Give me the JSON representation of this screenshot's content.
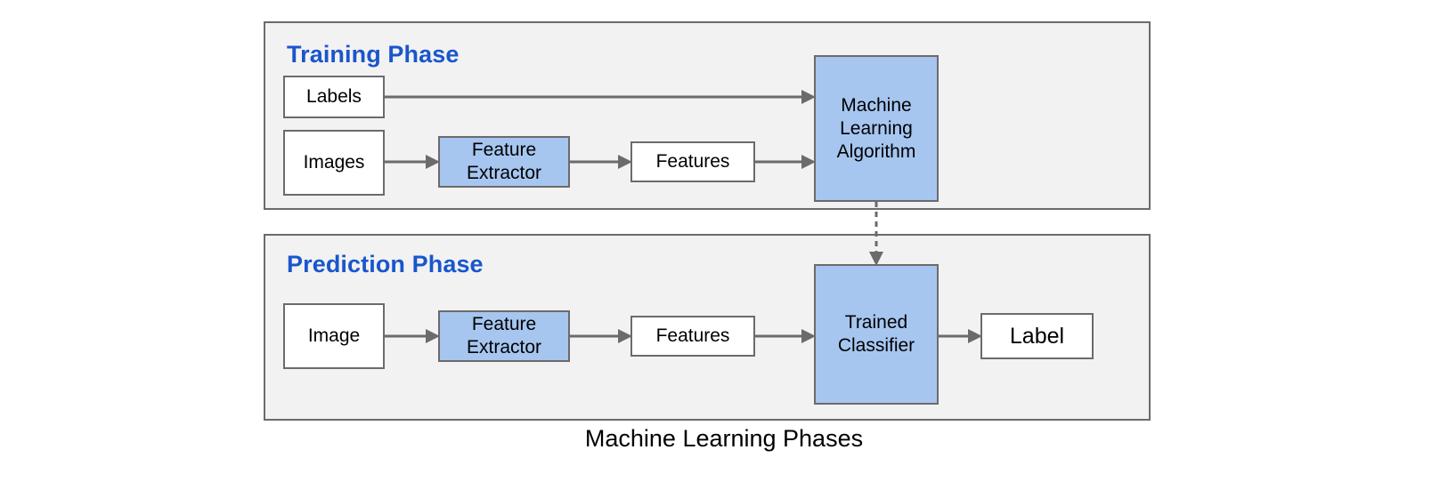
{
  "caption": "Machine Learning Phases",
  "colors": {
    "panel_background": "#f2f2f2",
    "panel_border": "#6b6b6b",
    "phase_title": "#1a56cc",
    "node_white": "#ffffff",
    "node_blue": "#a6c6f0",
    "node_border": "#6b6b6b",
    "connector": "#6b6b6b",
    "text": "#000000"
  },
  "phases": [
    {
      "id": "training",
      "title": "Training Phase",
      "nodes": [
        {
          "id": "labels",
          "label": "Labels",
          "style": "white"
        },
        {
          "id": "images",
          "label": "Images",
          "style": "white"
        },
        {
          "id": "feature_extractor",
          "label": "Feature\nExtractor",
          "style": "blue"
        },
        {
          "id": "features",
          "label": "Features",
          "style": "white"
        },
        {
          "id": "ml_algorithm",
          "label": "Machine\nLearning\nAlgorithm",
          "style": "blue"
        }
      ],
      "edges": [
        {
          "from": "labels",
          "to": "ml_algorithm",
          "style": "solid"
        },
        {
          "from": "images",
          "to": "feature_extractor",
          "style": "solid"
        },
        {
          "from": "feature_extractor",
          "to": "features",
          "style": "solid"
        },
        {
          "from": "features",
          "to": "ml_algorithm",
          "style": "solid"
        }
      ]
    },
    {
      "id": "prediction",
      "title": "Prediction Phase",
      "nodes": [
        {
          "id": "image",
          "label": "Image",
          "style": "white"
        },
        {
          "id": "feature_extractor",
          "label": "Feature\nExtractor",
          "style": "blue"
        },
        {
          "id": "features",
          "label": "Features",
          "style": "white"
        },
        {
          "id": "trained_classifier",
          "label": "Trained\nClassifier",
          "style": "blue"
        },
        {
          "id": "label",
          "label": "Label",
          "style": "white"
        }
      ],
      "edges": [
        {
          "from": "image",
          "to": "feature_extractor",
          "style": "solid"
        },
        {
          "from": "feature_extractor",
          "to": "features",
          "style": "solid"
        },
        {
          "from": "features",
          "to": "trained_classifier",
          "style": "solid"
        },
        {
          "from": "trained_classifier",
          "to": "label",
          "style": "solid"
        }
      ]
    }
  ],
  "cross_phase_edge": {
    "from": "ml_algorithm",
    "to": "trained_classifier",
    "style": "dashed",
    "direction": "down"
  }
}
